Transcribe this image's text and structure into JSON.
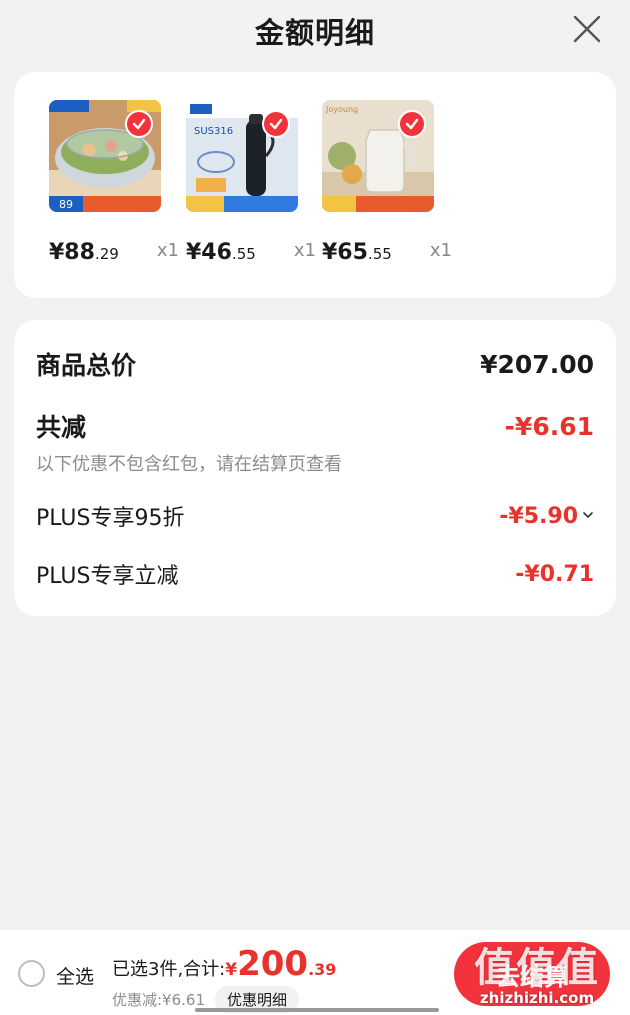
{
  "header": {
    "title": "金额明细"
  },
  "products": [
    {
      "price_main": "¥88",
      "price_dec": ".29",
      "qty": "x1",
      "thumb_icon": "pot-product-image",
      "tag": "89"
    },
    {
      "price_main": "¥46",
      "price_dec": ".55",
      "qty": "x1",
      "thumb_icon": "thermos-product-image",
      "tag": "SUS316"
    },
    {
      "price_main": "¥65",
      "price_dec": ".55",
      "qty": "x1",
      "thumb_icon": "kettle-product-image",
      "tag": "Joyoung"
    }
  ],
  "summary": {
    "total_label": "商品总价",
    "total_value": "¥207.00",
    "reduce_label": "共减",
    "reduce_value": "-¥6.61",
    "hint": "以下优惠不包含红包，请在结算页查看",
    "items": [
      {
        "label": "PLUS专享95折",
        "value": "-¥5.90",
        "chevron": "›"
      },
      {
        "label": "PLUS专享立减",
        "value": "-¥0.71"
      }
    ]
  },
  "bottom": {
    "select_all": "全选",
    "selected_label": "已选3件,合计:",
    "yen": "¥",
    "total_main": "200",
    "total_dec": ".39",
    "discount_text": "优惠减:¥6.61",
    "detail_chip": "优惠明细",
    "checkout": "去结算"
  },
  "watermark": {
    "big": "值值值",
    "small": "zhizhizhi.com"
  },
  "colors": {
    "accent": "#f2333c",
    "price_red": "#e8332c",
    "background": "#f2f2f2"
  }
}
